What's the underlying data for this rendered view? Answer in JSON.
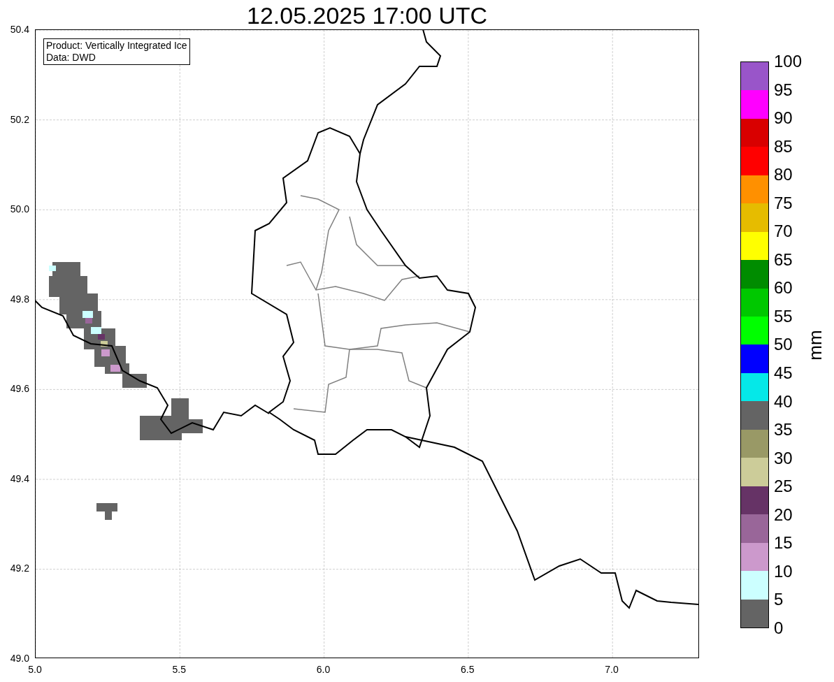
{
  "title": "12.05.2025 17:00 UTC",
  "info_box": [
    "Product: Vertically Integrated Ice",
    "Data: DWD"
  ],
  "y_ticks": [
    "50.4",
    "50.2",
    "50.0",
    "49.8",
    "49.6",
    "49.4",
    "49.2",
    "49.0"
  ],
  "x_ticks": [
    "5.0",
    "5.5",
    "6.0",
    "6.5",
    "7.0"
  ],
  "colorbar": {
    "label": "mm",
    "ticks": [
      "100",
      "95",
      "90",
      "85",
      "80",
      "75",
      "70",
      "65",
      "60",
      "55",
      "50",
      "45",
      "40",
      "35",
      "30",
      "25",
      "20",
      "15",
      "10",
      "5",
      "0"
    ],
    "bins": [
      {
        "color": "#646464"
      },
      {
        "color": "#ccffff"
      },
      {
        "color": "#cc99cc"
      },
      {
        "color": "#996699"
      },
      {
        "color": "#663366"
      },
      {
        "color": "#cccc99"
      },
      {
        "color": "#999966"
      },
      {
        "color": "#646464"
      },
      {
        "color": "#05e8e8"
      },
      {
        "color": "#0000ff"
      },
      {
        "color": "#00ff00"
      },
      {
        "color": "#00c800"
      },
      {
        "color": "#008c00"
      },
      {
        "color": "#ffff00"
      },
      {
        "color": "#e6bc00"
      },
      {
        "color": "#ff9000"
      },
      {
        "color": "#ff0000"
      },
      {
        "color": "#d90000"
      },
      {
        "color": "#ff00ff"
      },
      {
        "color": "#9955c9"
      }
    ]
  }
}
